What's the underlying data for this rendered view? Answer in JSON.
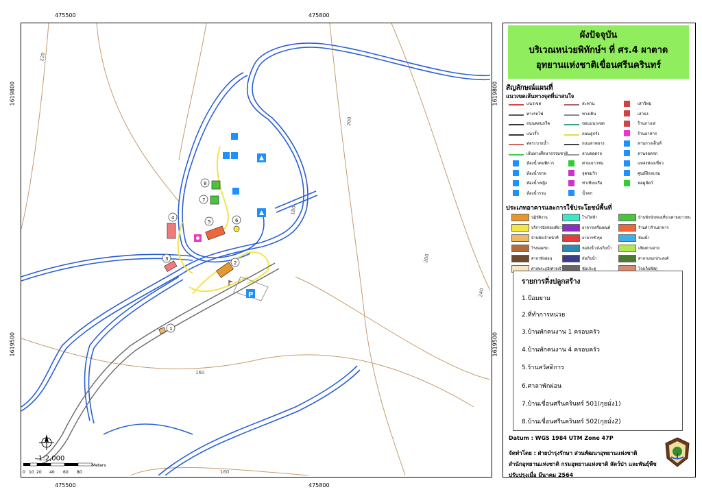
{
  "coords": {
    "top_x": [
      "475500",
      "475800"
    ],
    "bottom_x": [
      "475500",
      "475800"
    ],
    "left_y": [
      "1619800",
      "1619500"
    ],
    "right_y": [
      "1619800",
      "1619500"
    ]
  },
  "contours": {
    "labels": [
      "220",
      "200",
      "180",
      "200",
      "240",
      "160",
      "160"
    ]
  },
  "buildings": {
    "numbers": [
      "1",
      "2",
      "3",
      "4",
      "5",
      "6",
      "7",
      "8"
    ]
  },
  "scale": {
    "ratio": "1:2,000",
    "ticks": [
      "0",
      "10",
      "20",
      "40",
      "60",
      "80"
    ],
    "unit": "Meters"
  },
  "title": {
    "line1": "ผังปัจจุบัน",
    "line2": "บริเวณหน่วยพิทักษ์ฯ ที่ ศร.4 ผาตาด",
    "line3": "อุทยานแห่งชาติเขื่อนศรีนครินทร์"
  },
  "legend": {
    "heading": "สัญลักษณ์แผนที่",
    "subheading": "แนวเขตเส้นทางจุดที่น่าสนใจ",
    "items": [
      {
        "label": "แนวเขต",
        "sym": "line",
        "color": "#d44"
      },
      {
        "label": "ทางรถไฟ",
        "sym": "line",
        "color": "#555"
      },
      {
        "label": "ถนนคอนกรีต",
        "sym": "line",
        "color": "#333"
      },
      {
        "label": "แนวรั้ว",
        "sym": "line",
        "color": "#333"
      },
      {
        "label": "ท่อระบายน้ำ",
        "sym": "line",
        "color": "#c66"
      },
      {
        "label": "เส้นทางศึกษาธรรมชาติ",
        "sym": "line",
        "color": "#4c4"
      },
      {
        "label": "ห้องน้ำคนพิการ",
        "sym": "icon",
        "color": "#1e90ff"
      },
      {
        "label": "ห้องน้ำชาย",
        "sym": "icon",
        "color": "#1e90ff"
      },
      {
        "label": "ห้องน้ำหญิง",
        "sym": "icon",
        "color": "#1e90ff"
      },
      {
        "label": "ห้องน้ำรวม",
        "sym": "icon",
        "color": "#1e90ff"
      },
      {
        "label": "สะพาน",
        "sym": "line",
        "color": "#a66"
      },
      {
        "label": "ทางเดิน",
        "sym": "line",
        "color": "#888"
      },
      {
        "label": "ขอบแนวเขต",
        "sym": "line",
        "color": "#3a7"
      },
      {
        "label": "ถนนลูกรัง",
        "sym": "line",
        "color": "#e8d84a"
      },
      {
        "label": "ถนนลาดยาง",
        "sym": "line",
        "color": "#444"
      },
      {
        "label": "ลานจอดรถ",
        "sym": "line",
        "color": "#999"
      },
      {
        "label": "ค่ายเยาวชน",
        "sym": "icon",
        "color": "#3c3"
      },
      {
        "label": "จุดชมวิว",
        "sym": "icon",
        "color": "#c3c"
      },
      {
        "label": "ท่าเทียบเรือ",
        "sym": "icon",
        "color": "#c3c"
      },
      {
        "label": "น้ำตก",
        "sym": "icon",
        "color": "#1e90ff"
      },
      {
        "label": "เสาวิทยุ",
        "sym": "icon",
        "color": "#c44"
      },
      {
        "label": "เสาธง",
        "sym": "icon",
        "color": "#c44"
      },
      {
        "label": "ร้านกาแฟ",
        "sym": "icon",
        "color": "#c44"
      },
      {
        "label": "ร้านอาหาร",
        "sym": "icon",
        "color": "#e3c"
      },
      {
        "label": "ลานกางเต็นท์",
        "sym": "icon",
        "color": "#1e90ff"
      },
      {
        "label": "ลานจอดรถ",
        "sym": "icon",
        "color": "#1e90ff"
      },
      {
        "label": "แหล่งท่องเที่ยว",
        "sym": "icon",
        "color": "#1e90ff"
      },
      {
        "label": "ศูนย์ฝึกอบรม",
        "sym": "icon",
        "color": "#1e90ff"
      },
      {
        "label": "หอดูสัตว์",
        "sym": "icon",
        "color": "#3c3"
      }
    ],
    "building_heading": "ประเภทอาคารและการใช้ประโยชน์พื้นที่",
    "swatches": [
      {
        "label": "ปฏิบัติงาน",
        "color": "#e8962e"
      },
      {
        "label": "บริการนักท่องเที่ยว",
        "color": "#f5e642"
      },
      {
        "label": "บ้านพักเจ้าหน้าที่",
        "color": "#f0b866"
      },
      {
        "label": "โรงจอดรถ",
        "color": "#b36b3c"
      },
      {
        "label": "ศาลาพักผ่อน",
        "color": "#6b4a2e"
      },
      {
        "label": "ศาลพระภูมิ/ศาลเจ้าที่",
        "color": "#f5e6c4"
      },
      {
        "label": "โรงไฟฟ้า",
        "color": "#3ee8c4"
      },
      {
        "label": "อาคารเครื่องยนต์",
        "color": "#8a2ec4"
      },
      {
        "label": "อาคารชำรุด",
        "color": "#e83c3c"
      },
      {
        "label": "หอถังน้ำ/ถังเก็บน้ำ",
        "color": "#2e8ab3"
      },
      {
        "label": "ถังเก็บน้ำ",
        "color": "#3c3c8a"
      },
      {
        "label": "ซุ้มประตู",
        "color": "#666666"
      },
      {
        "label": "บ้านพักนักท่องเที่ยว/ค่ายเยาวชน",
        "color": "#4ac43c"
      },
      {
        "label": "ร้านค้า/ร้านอาหาร",
        "color": "#f0663c"
      },
      {
        "label": "ห้องน้ำ",
        "color": "#3cb0e8"
      },
      {
        "label": "เสียงตามสาย",
        "color": "#b3e84a"
      },
      {
        "label": "ศาลาเอนกประสงค์",
        "color": "#4a7a2e"
      },
      {
        "label": "โรงเก็บพัสดุ",
        "color": "#d48a6b"
      }
    ]
  },
  "building_list": {
    "heading": "รายการสิ่งปลูกสร้าง",
    "items": [
      "1.ป้อมยาม",
      "2.ที่ทำการหน่วย",
      "3.บ้านพักคนงาน 1 ครอบครัว",
      "4.บ้านพักคนงาน 4 ครอบครัว",
      "5.ร้านสวัสดิการ",
      "6.ศาลาพักผ่อน",
      "7.บ้านเขื่อนศรีนครินทร์ 501(กุยมั่ง1)",
      "8.บ้านเขื่อนศรีนครินทร์ 502(กุยมั่ง2)"
    ]
  },
  "info": {
    "datum": "Datum  : WGS 1984 UTM Zone 47P",
    "prepared_by": "จัดทำโดย  : ฝ่ายบำรุงรักษา ส่วนพัฒนาอุทยานแห่งชาติ",
    "office": "สำนักอุทยานแห่งชาติ  กรมอุทยานแห่งชาติ สัตว์ป่า และพันธุ์พืช",
    "updated": "ปรับปรุงเมื่อ มีนาคม 2564"
  },
  "colors": {
    "stream": "#2a5fd6",
    "contour": "#c49a6c",
    "road": "#666666",
    "dirt_road": "#f2e44a",
    "title_bg": "#90ee5e"
  }
}
